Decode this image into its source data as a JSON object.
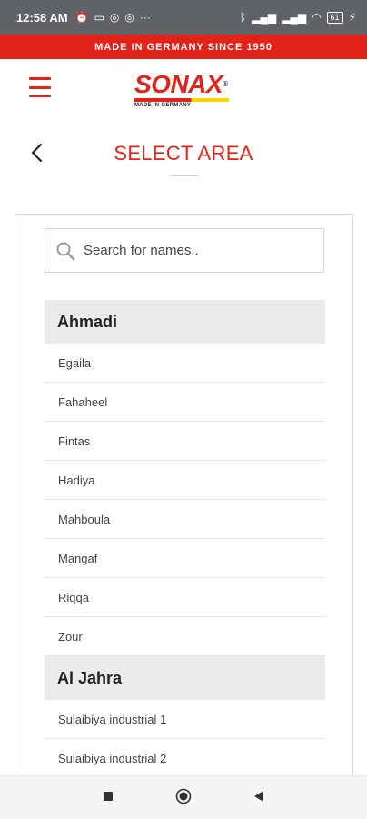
{
  "status_bar": {
    "time": "12:58 AM",
    "left_icons": [
      "alarm-icon",
      "message-icon",
      "app-icon-1",
      "app-icon-2",
      "more-icon"
    ],
    "right_icons": [
      "bluetooth-icon",
      "signal-icon",
      "signal-icon-2",
      "wifi-icon"
    ],
    "battery": "61"
  },
  "banner": {
    "text": "MADE IN GERMANY SINCE 1950"
  },
  "header": {
    "logo_text": "SONAX",
    "logo_trademark": "®",
    "logo_subtitle": "MADE IN GERMANY",
    "brand_color": "#e2231a",
    "accent_color": "#ffd400"
  },
  "page": {
    "title": "SELECT AREA"
  },
  "search": {
    "placeholder": "Search for names.."
  },
  "groups": [
    {
      "name": "Ahmadi",
      "items": [
        "Egaila",
        "Fahaheel",
        "Fintas",
        "Hadiya",
        "Mahboula",
        "Mangaf",
        "Riqqa",
        "Zour"
      ]
    },
    {
      "name": "Al Jahra",
      "items": [
        "Sulaibiya industrial 1",
        "Sulaibiya industrial 2"
      ]
    }
  ]
}
